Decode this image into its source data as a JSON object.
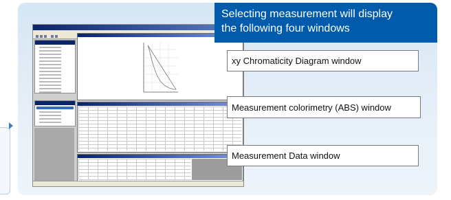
{
  "callout": {
    "line1": "Selecting measurement will display",
    "line2": "the following four windows"
  },
  "labels": {
    "xy": "xy Chromaticity Diagram window",
    "abs": "Measurement colorimetry (ABS) window",
    "data": "Measurement Data window"
  },
  "colors": {
    "banner": "#005bac",
    "panel": "#dbe8f5",
    "accent_arrow": "#3a7fc1"
  }
}
